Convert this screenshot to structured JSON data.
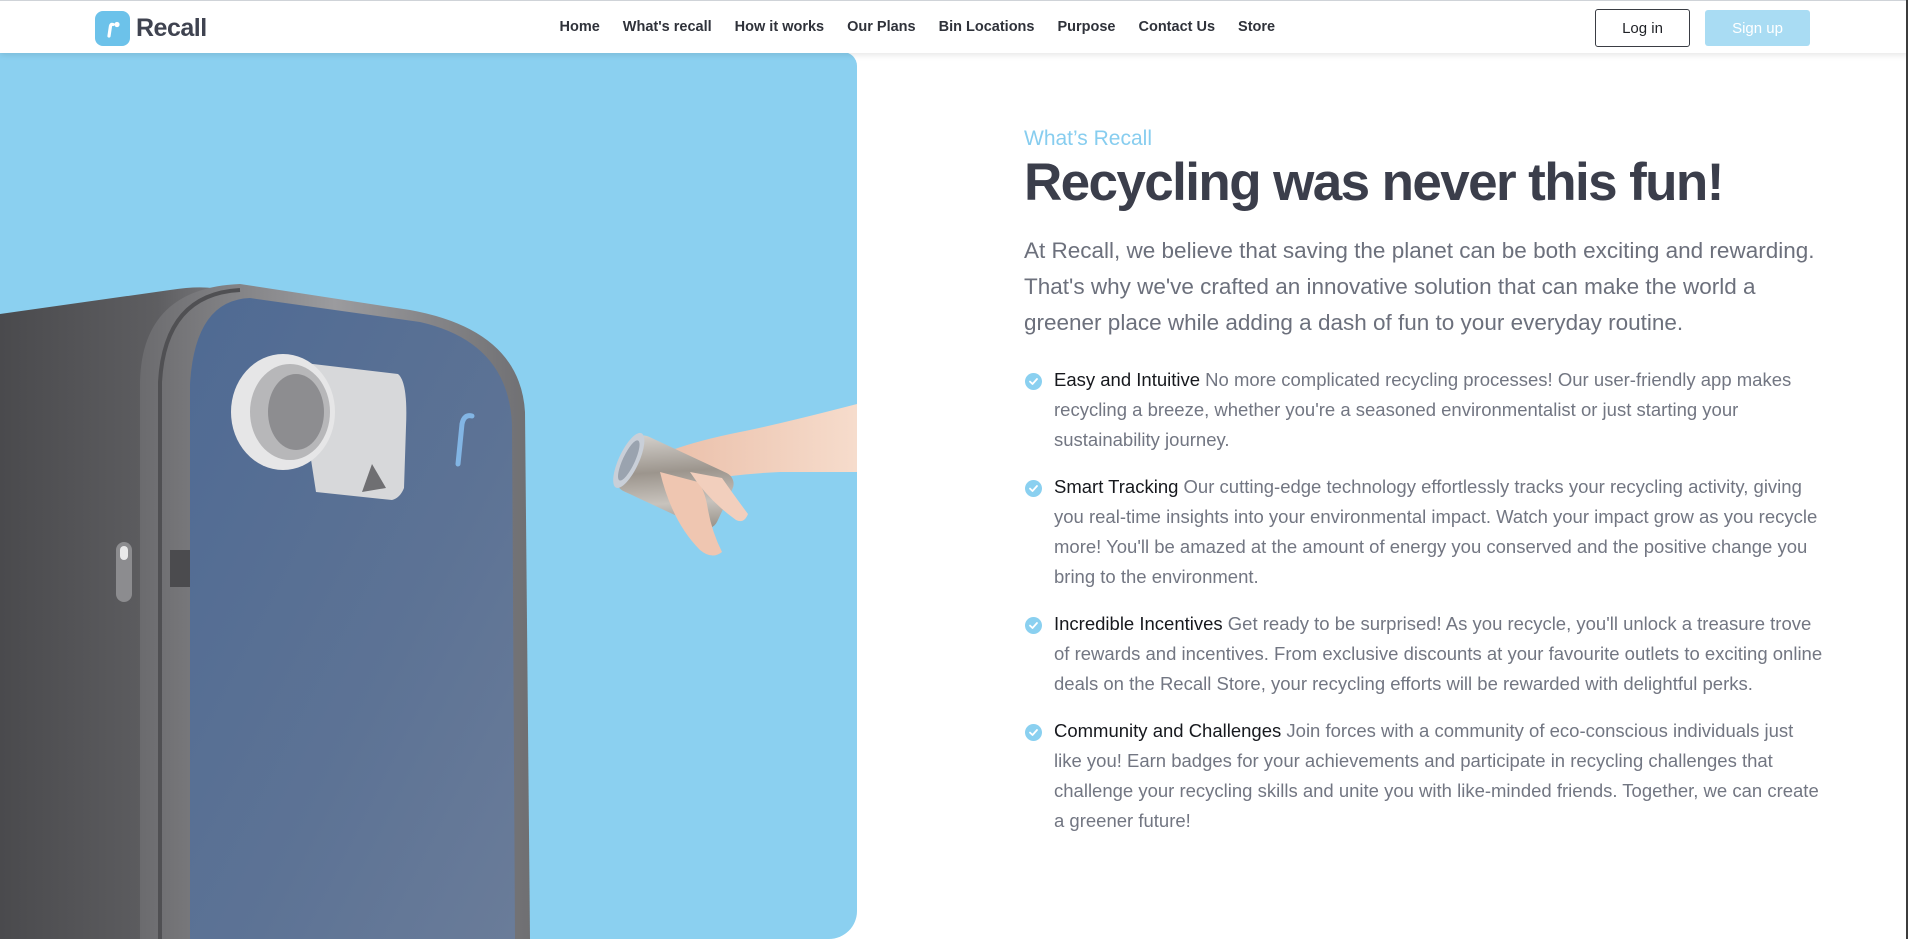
{
  "brand": {
    "name": "Recall",
    "accent_color": "#8bd0f0",
    "logo_icon": "recall-logo-icon"
  },
  "nav": {
    "items": [
      {
        "label": "Home"
      },
      {
        "label": "What's recall"
      },
      {
        "label": "How it works"
      },
      {
        "label": "Our Plans"
      },
      {
        "label": "Bin Locations"
      },
      {
        "label": "Purpose"
      },
      {
        "label": "Contact Us"
      },
      {
        "label": "Store"
      }
    ]
  },
  "auth": {
    "login_label": "Log in",
    "signup_label": "Sign up"
  },
  "hero": {
    "image": "recycling-bin-with-hand-holding-can",
    "background_color": "#8bd0f0"
  },
  "section": {
    "eyebrow": "What’s Recall",
    "title": "Recycling was never this fun!",
    "intro": "At Recall, we believe that saving the planet can be both exciting and rewarding. That's why we've crafted an innovative solution that can make the world a greener place while adding a dash of fun to your everyday routine.",
    "check_icon": "check-circle-icon",
    "features": [
      {
        "title": "Easy and Intuitive",
        "text": "No more complicated recycling processes! Our user-friendly app makes recycling a breeze, whether you're a seasoned environmentalist or just starting your sustainability journey."
      },
      {
        "title": "Smart Tracking",
        "text": "Our cutting-edge technology effortlessly tracks your recycling activity, giving you real-time insights into your environmental impact. Watch your impact grow as you recycle more! You'll be amazed at the amount of energy you conserved and the positive change you bring to the environment."
      },
      {
        "title": "Incredible Incentives",
        "text": "Get ready to be surprised! As you recycle, you'll unlock a treasure trove of rewards and incentives. From exclusive discounts at your favourite outlets to exciting online deals on the Recall Store, your recycling efforts will be rewarded with delightful perks."
      },
      {
        "title": "Community and Challenges",
        "text": "Join forces with a community of eco-conscious individuals just like you! Earn badges for your achievements and participate in recycling challenges that challenge your recycling skills and unite you with like-minded friends. Together, we can create a greener future!"
      }
    ]
  }
}
